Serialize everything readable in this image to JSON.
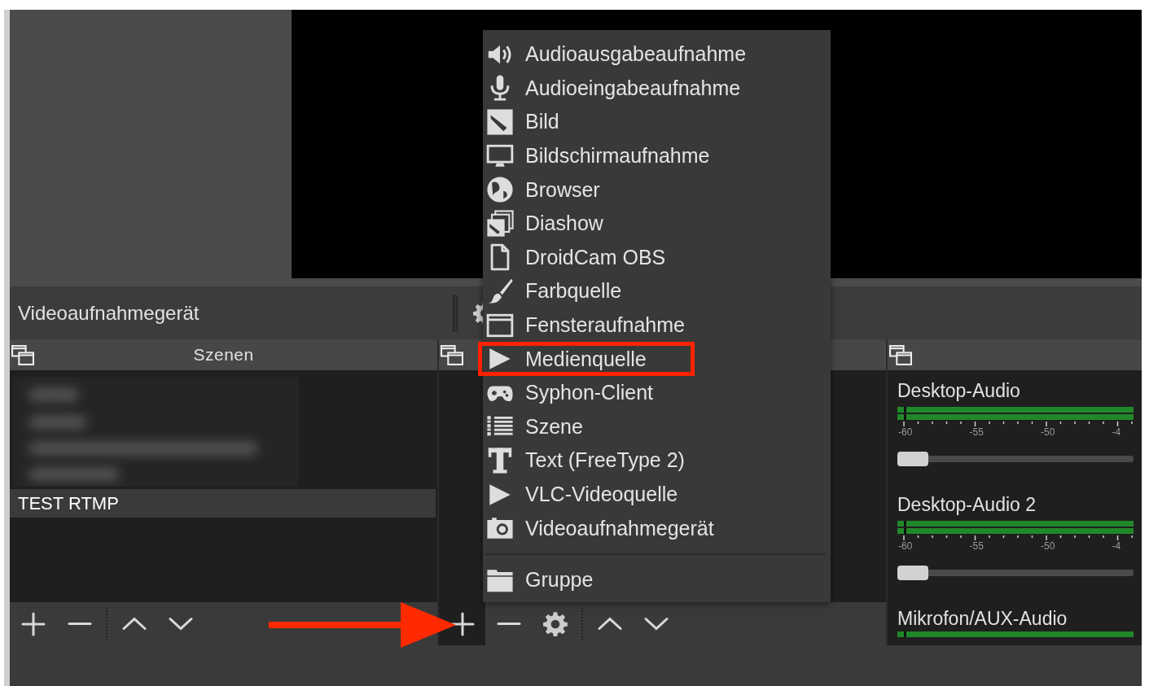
{
  "source_bar": {
    "label": "Videoaufnahmegerät"
  },
  "scenes": {
    "title": "Szenen",
    "items": [
      {
        "label": "TEST RTMP",
        "selected": true
      }
    ],
    "toolbar": [
      {
        "kind": "add",
        "active": false
      },
      {
        "kind": "remove",
        "active": false
      },
      {
        "kind": "separator"
      },
      {
        "kind": "up",
        "active": false
      },
      {
        "kind": "down",
        "active": false
      }
    ]
  },
  "sources": {
    "toolbar": [
      {
        "kind": "add",
        "active": true
      },
      {
        "kind": "remove",
        "active": false
      },
      {
        "kind": "properties",
        "active": false
      },
      {
        "kind": "separator"
      },
      {
        "kind": "up",
        "active": false
      },
      {
        "kind": "down",
        "active": false
      }
    ]
  },
  "mixer": {
    "channels": [
      {
        "name": "Desktop-Audio",
        "ticks": [
          "-60",
          "-55",
          "-50",
          "-4"
        ],
        "level": 0
      },
      {
        "name": "Desktop-Audio 2",
        "ticks": [
          "-60",
          "-55",
          "-50",
          "-4"
        ],
        "level": 0
      },
      {
        "name": "Mikrofon/AUX-Audio"
      }
    ]
  },
  "menu": {
    "items": [
      {
        "label": "Audioausgabeaufnahme",
        "annotated": false
      },
      {
        "label": "Audioeingabeaufnahme",
        "annotated": false
      },
      {
        "label": "Bild",
        "annotated": false
      },
      {
        "label": "Bildschirmaufnahme",
        "annotated": false
      },
      {
        "label": "Browser",
        "annotated": false
      },
      {
        "label": "Diashow",
        "annotated": false
      },
      {
        "label": "DroidCam OBS",
        "annotated": false
      },
      {
        "label": "Farbquelle",
        "annotated": false
      },
      {
        "label": "Fensteraufnahme",
        "annotated": false
      },
      {
        "label": "Medienquelle",
        "annotated": true
      },
      {
        "label": "Syphon-Client",
        "annotated": false
      },
      {
        "label": "Szene",
        "annotated": false
      },
      {
        "label": "Text (FreeType 2)",
        "annotated": false
      },
      {
        "label": "VLC-Videoquelle",
        "annotated": false
      },
      {
        "label": "Videoaufnahmegerät",
        "annotated": false
      },
      {
        "kind": "separator"
      },
      {
        "label": "Gruppe",
        "annotated": false
      }
    ]
  }
}
